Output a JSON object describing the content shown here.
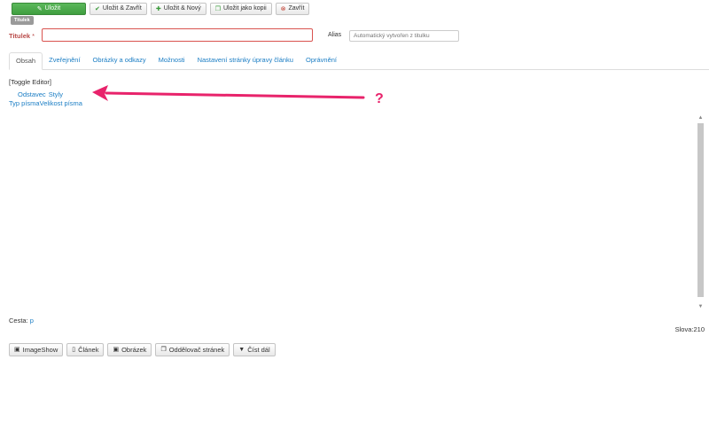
{
  "toolbar": {
    "save": "Uložit",
    "save_close": "Uložit & Zavřít",
    "save_new": "Uložit & Nový",
    "save_copy": "Uložit jako kopii",
    "close": "Zavřít"
  },
  "tooltip": "Titulek",
  "form": {
    "title_label": "Titulek",
    "required_mark": "*",
    "title_value": "",
    "alias_label": "Alias",
    "alias_placeholder": "Automatický vytvořen z titulku"
  },
  "tabs": [
    {
      "label": "Obsah",
      "active": true
    },
    {
      "label": "Zveřejnění"
    },
    {
      "label": "Obrázky a odkazy"
    },
    {
      "label": "Možnosti"
    },
    {
      "label": "Nastavení stránky úpravy článku"
    },
    {
      "label": "Oprávnění"
    }
  ],
  "editor": {
    "toggle": "[Toggle Editor]",
    "row1": [
      "Odstavec",
      "Styly"
    ],
    "row2": [
      "Typ písma",
      "Velikost písma"
    ]
  },
  "status": {
    "path_label": "Cesta:",
    "path_value": "p",
    "word_count": "Slova:210"
  },
  "bottom_buttons": {
    "imageshow": "ImageShow",
    "article": "Článek",
    "image": "Obrázek",
    "pagebreak": "Oddělovač stránek",
    "readmore": "Číst dál"
  },
  "annotation": {
    "mark": "?",
    "color": "#e8236b"
  }
}
